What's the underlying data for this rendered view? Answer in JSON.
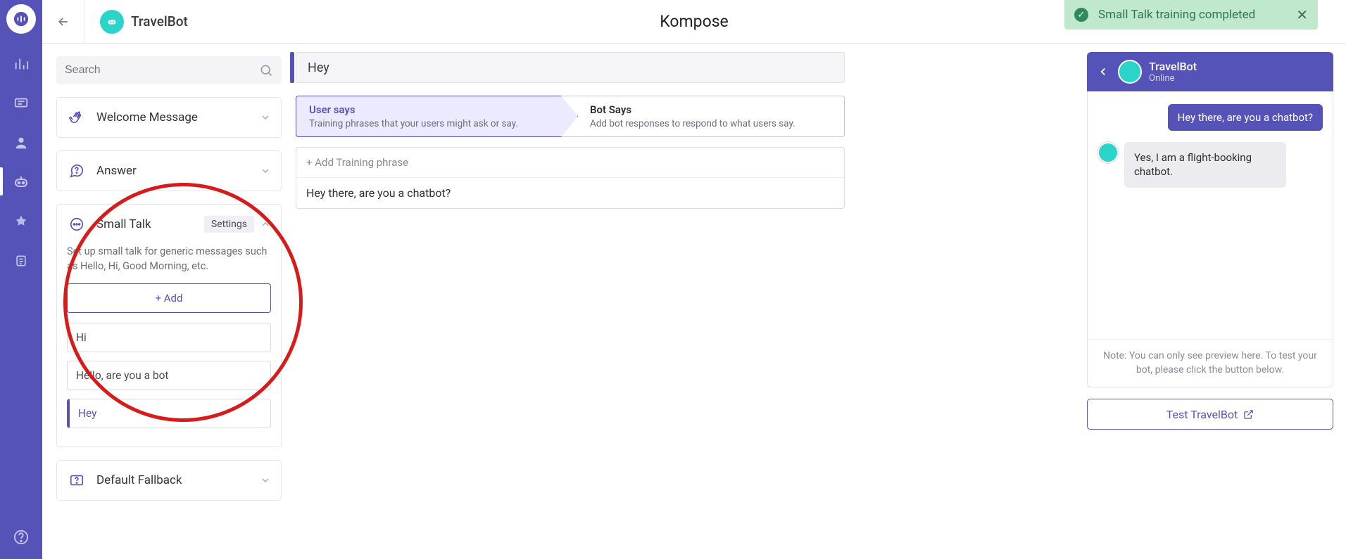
{
  "notification": {
    "text": "Small Talk training completed"
  },
  "header": {
    "bot_name": "TravelBot",
    "center_title": "Kompose"
  },
  "search": {
    "placeholder": "Search"
  },
  "sections": {
    "welcome": {
      "label": "Welcome Message"
    },
    "answer": {
      "label": "Answer"
    },
    "small_talk": {
      "label": "Small Talk",
      "settings_label": "Settings",
      "desc": "Set up small talk for generic messages such as Hello, Hi, Good Morning, etc.",
      "add_label": "+ Add",
      "items": [
        "Hi",
        "Hello, are you a bot",
        "Hey"
      ]
    },
    "fallback": {
      "label": "Default Fallback"
    }
  },
  "editor": {
    "title": "Hey",
    "step1": {
      "title": "User says",
      "desc": "Training phrases that your users might ask or say."
    },
    "step2": {
      "title": "Bot Says",
      "desc": "Add bot responses to respond to what users say."
    },
    "add_phrase_label": "+ Add Training phrase",
    "phrases": [
      "Hey there, are you a chatbot?"
    ]
  },
  "preview": {
    "bot_name": "TravelBot",
    "status": "Online",
    "user_msg": "Hey there, are you a chatbot?",
    "bot_msg": "Yes, I am a flight-booking chatbot.",
    "note": "Note: You can only see preview here. To test your bot, please click the button below.",
    "test_label": "Test TravelBot"
  }
}
